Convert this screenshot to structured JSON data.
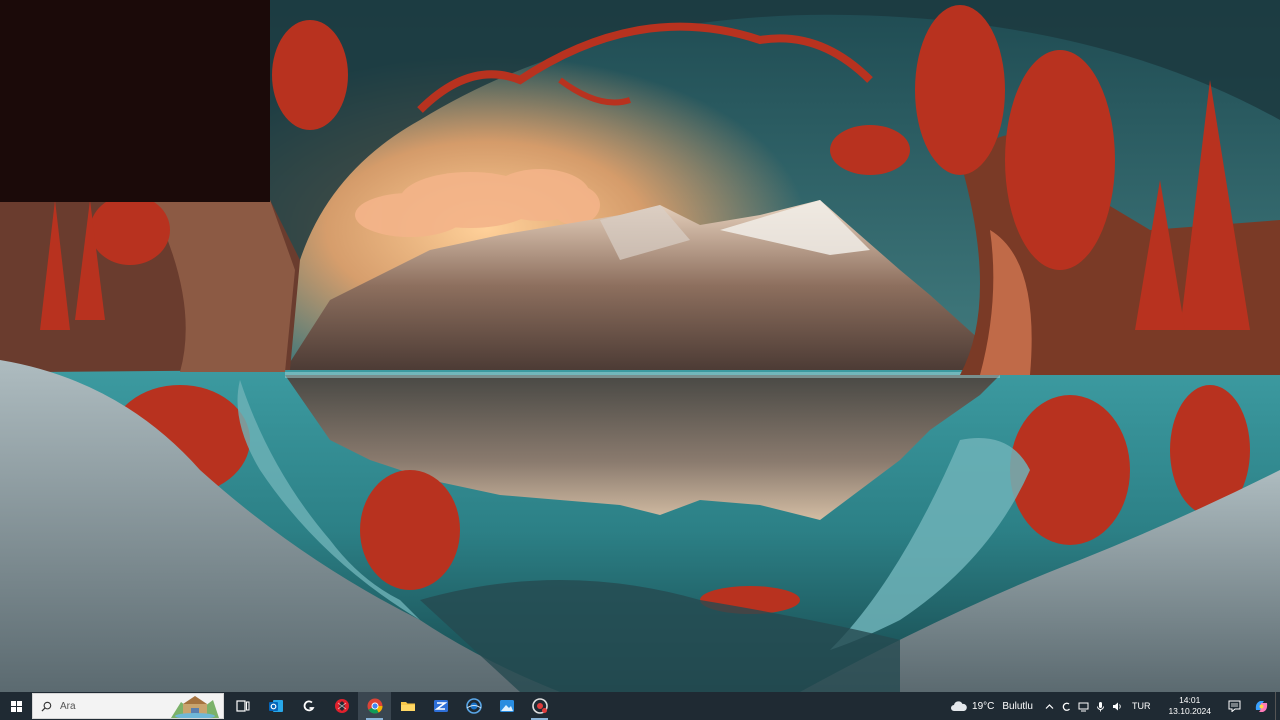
{
  "desktop": {
    "wallpaper": "fantasy-landscape-mountain-lake-red-trees",
    "colors": {
      "sky_teal": "#3f7e82",
      "lake": "#2f8f93",
      "glow": "#f2a66b",
      "trees": "#b8321f",
      "snow": "#b9c6c9"
    }
  },
  "taskbar": {
    "background": "#1f2a33",
    "search": {
      "placeholder": "Ara"
    },
    "apps": [
      {
        "name": "task-view-icon"
      },
      {
        "name": "outlook-icon"
      },
      {
        "name": "app-g-icon"
      },
      {
        "name": "opera-icon"
      },
      {
        "name": "chrome-icon",
        "active": true
      },
      {
        "name": "file-explorer-icon"
      },
      {
        "name": "app-z-icon"
      },
      {
        "name": "app-blue-circle-icon"
      },
      {
        "name": "photos-icon"
      },
      {
        "name": "app-chrome-canary-icon"
      }
    ],
    "weather": {
      "temperature": "19°C",
      "condition": "Bulutlu"
    },
    "language": "TUR",
    "clock": {
      "time": "14:01",
      "date": "13.10.2024"
    }
  }
}
